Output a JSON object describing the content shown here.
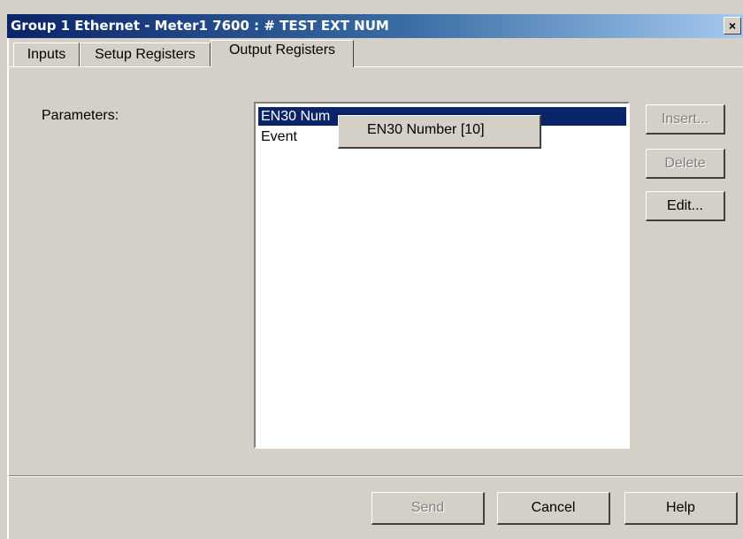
{
  "window": {
    "title": "Group 1 Ethernet - Meter1 7600 : # TEST EXT NUM",
    "close_glyph": "×",
    "close_icon": "close-icon"
  },
  "tabs": [
    {
      "label": "Inputs",
      "active": false
    },
    {
      "label": "Setup Registers",
      "active": false
    },
    {
      "label": "Output Registers",
      "active": true
    }
  ],
  "parameters": {
    "label": "Parameters:",
    "items": [
      {
        "label": "EN30 Num",
        "selected": true
      },
      {
        "label": "Event",
        "selected": false
      }
    ],
    "tooltip": "EN30 Number [10]"
  },
  "side_buttons": {
    "insert": {
      "label": "Insert...",
      "enabled": false
    },
    "delete": {
      "label": "Delete",
      "enabled": false
    },
    "edit": {
      "label": "Edit...",
      "enabled": true
    }
  },
  "footer_buttons": {
    "send": {
      "label": "Send",
      "enabled": false
    },
    "cancel": {
      "label": "Cancel",
      "enabled": true
    },
    "help": {
      "label": "Help",
      "enabled": true
    }
  },
  "colors": {
    "face": "#d4d0c8",
    "title_start": "#0a246a",
    "title_end": "#a6caf0",
    "selection": "#0a246a",
    "disabled_text": "#808080"
  }
}
